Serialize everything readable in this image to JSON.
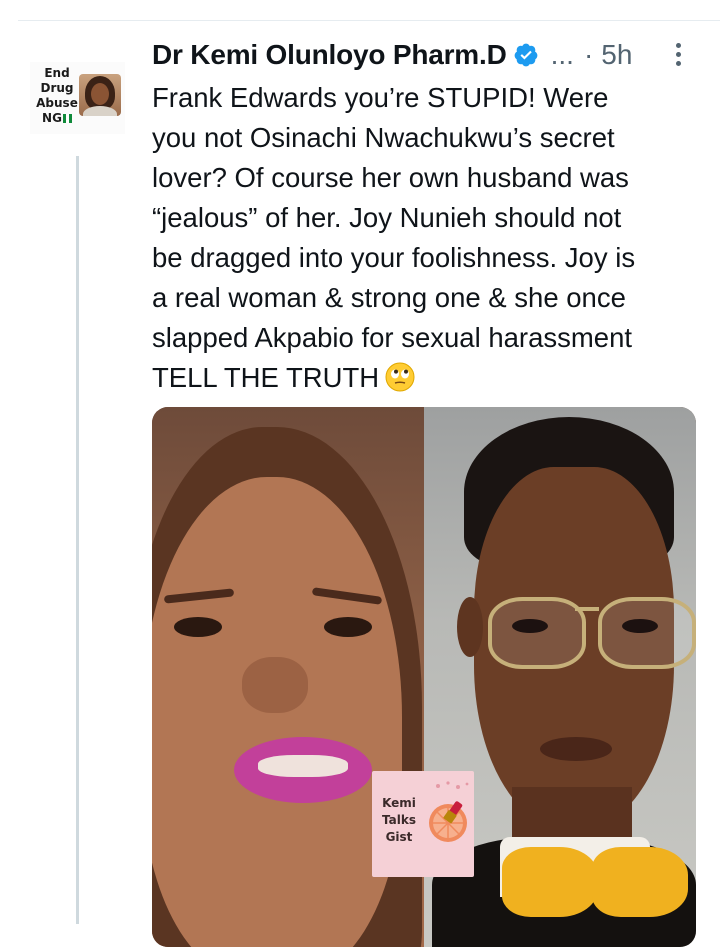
{
  "tweet": {
    "author": {
      "name": "Dr Kemi Olunloyo Pharm.D",
      "verified": true,
      "avatar_badge_lines": [
        "End",
        "Drug",
        "Abuse",
        "NG"
      ],
      "avatar_flag": "nigeria-flag-icon"
    },
    "header": {
      "ellipsis": "...",
      "separator": "·",
      "time": "5h"
    },
    "text_lines": [
      "Frank Edwards you’re STUPID! Were",
      "you not Osinachi Nwachukwu’s secret",
      "lover? Of course her own husband was",
      "“jealous” of her. Joy Nunieh should not",
      "be dragged into your foolishness. Joy is",
      "a real woman & strong one & she once",
      "slapped Akpabio for sexual harassment",
      "TELL THE TRUTH"
    ],
    "text_end_emoji": "face-with-rolling-eyes-icon",
    "media": {
      "kind": "photo-collage",
      "panels": [
        "woman-portrait",
        "man-portrait-with-glasses"
      ],
      "watermark_lines": [
        "Kemi",
        "Talks",
        "Gist"
      ],
      "watermark_icon": "grapefruit-lipstick-icon"
    }
  },
  "colors": {
    "text": "#0f1419",
    "secondary": "#536471",
    "verified": "#1d9bf0",
    "thread_line": "#cfd9de",
    "divider": "#e6ecf0"
  }
}
